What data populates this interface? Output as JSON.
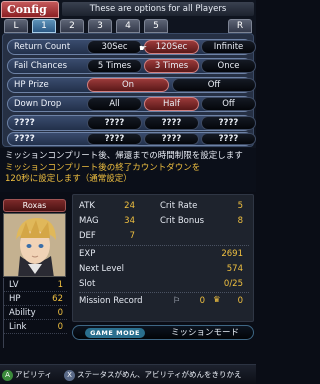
{
  "header": {
    "title": "Config",
    "hint": "These are options for all Players"
  },
  "tabs": [
    {
      "label": "L"
    },
    {
      "label": "1"
    },
    {
      "label": "2"
    },
    {
      "label": "3"
    },
    {
      "label": "4"
    },
    {
      "label": "5"
    },
    {
      "label": "R"
    }
  ],
  "active_tab": "1",
  "options": [
    {
      "label": "Return Count",
      "choices": [
        "30Sec",
        "120Sec",
        "Infinite"
      ],
      "selected": "120Sec"
    },
    {
      "label": "Fail Chances",
      "choices": [
        "5 Times",
        "3 Times",
        "Once"
      ],
      "selected": "3 Times"
    },
    {
      "label": "HP Prize",
      "choices": [
        "On",
        "Off"
      ],
      "selected": "On"
    },
    {
      "label": "Down Drop",
      "choices": [
        "All",
        "Half",
        "Off"
      ],
      "selected": "Half"
    },
    {
      "label": "????",
      "choices": [
        "????",
        "????",
        "????"
      ],
      "selected": "????"
    },
    {
      "label": "????",
      "choices": [
        "????",
        "????",
        "????"
      ],
      "selected": "????"
    }
  ],
  "description": {
    "line1": "ミッションコンプリート後、帰還までの時間制限を設定します",
    "line2": "ミッションコンプリート後の終了カウントダウンを",
    "line3": "120秒に設定します（通常設定）"
  },
  "character": {
    "name": "Roxas",
    "lv_label": "LV",
    "lv": "1",
    "hp_label": "HP",
    "hp": "62",
    "ability_label": "Ability",
    "ability": "0",
    "link_label": "Link",
    "link": "0"
  },
  "stats": {
    "atk_label": "ATK",
    "atk": "24",
    "mag_label": "MAG",
    "mag": "34",
    "def_label": "DEF",
    "def": "7",
    "crit_rate_label": "Crit Rate",
    "crit_rate": "5",
    "crit_bonus_label": "Crit Bonus",
    "crit_bonus": "8",
    "exp_label": "EXP",
    "exp": "2691",
    "next_label": "Next Level",
    "next": "574",
    "slot_label": "Slot",
    "slot": "0/25",
    "mission_label": "Mission Record",
    "mission_a": "0",
    "mission_b": "0"
  },
  "mode": {
    "tag": "GAME MODE",
    "value": "ミッションモード"
  },
  "bottom_bar": {
    "left_label": "アビリティ",
    "right_label": "ステータスがめん、アビリティがめんをきりかえ",
    "left_button": "A",
    "right_button": "X"
  },
  "colors": {
    "selected_chip": "#9b3a3a",
    "value_yellow": "#f0c040",
    "description_yellow": "#f0c040",
    "title_red": "#8a1f23",
    "active_tab": "#2c5a86"
  }
}
